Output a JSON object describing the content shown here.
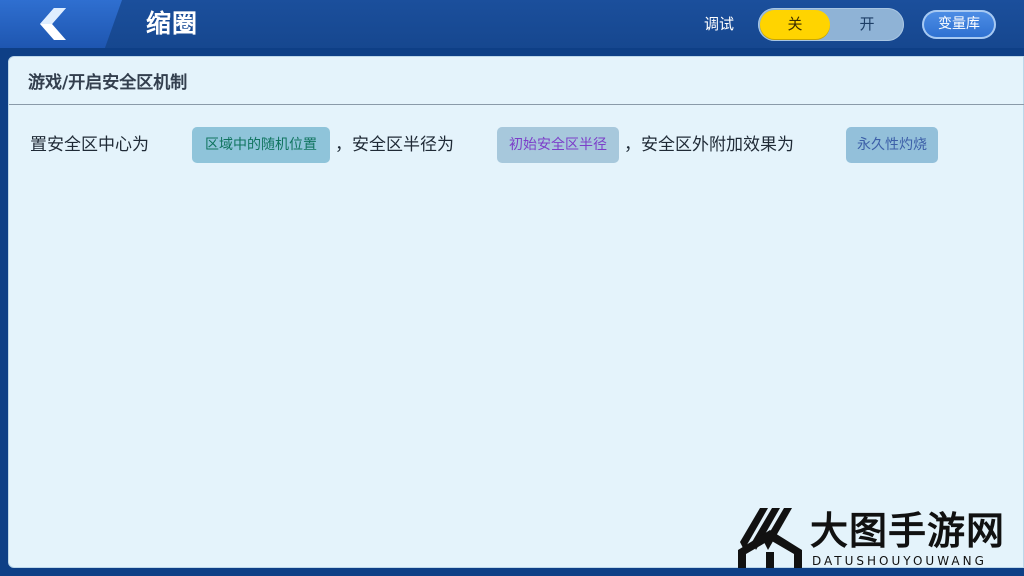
{
  "header": {
    "title": "缩圈",
    "back_icon": "back-arrow-icon",
    "debug": {
      "label": "调试",
      "off_label": "关",
      "on_label": "开",
      "selected": "关",
      "off_color": "#ffd400"
    },
    "variables_button": "变量库"
  },
  "panel": {
    "breadcrumb": "游戏/开启安全区机制",
    "statement": {
      "part1": "置安全区中心为",
      "chip1": "区域中的随机位置",
      "part2": "，安全区半径为",
      "chip2": "初始安全区半径",
      "part3": "，安全区外附加效果为",
      "chip3": "永久性灼烧"
    }
  },
  "watermark": {
    "title": "大图手游网",
    "subtitle": "DATUSHOUYOUWANG"
  }
}
